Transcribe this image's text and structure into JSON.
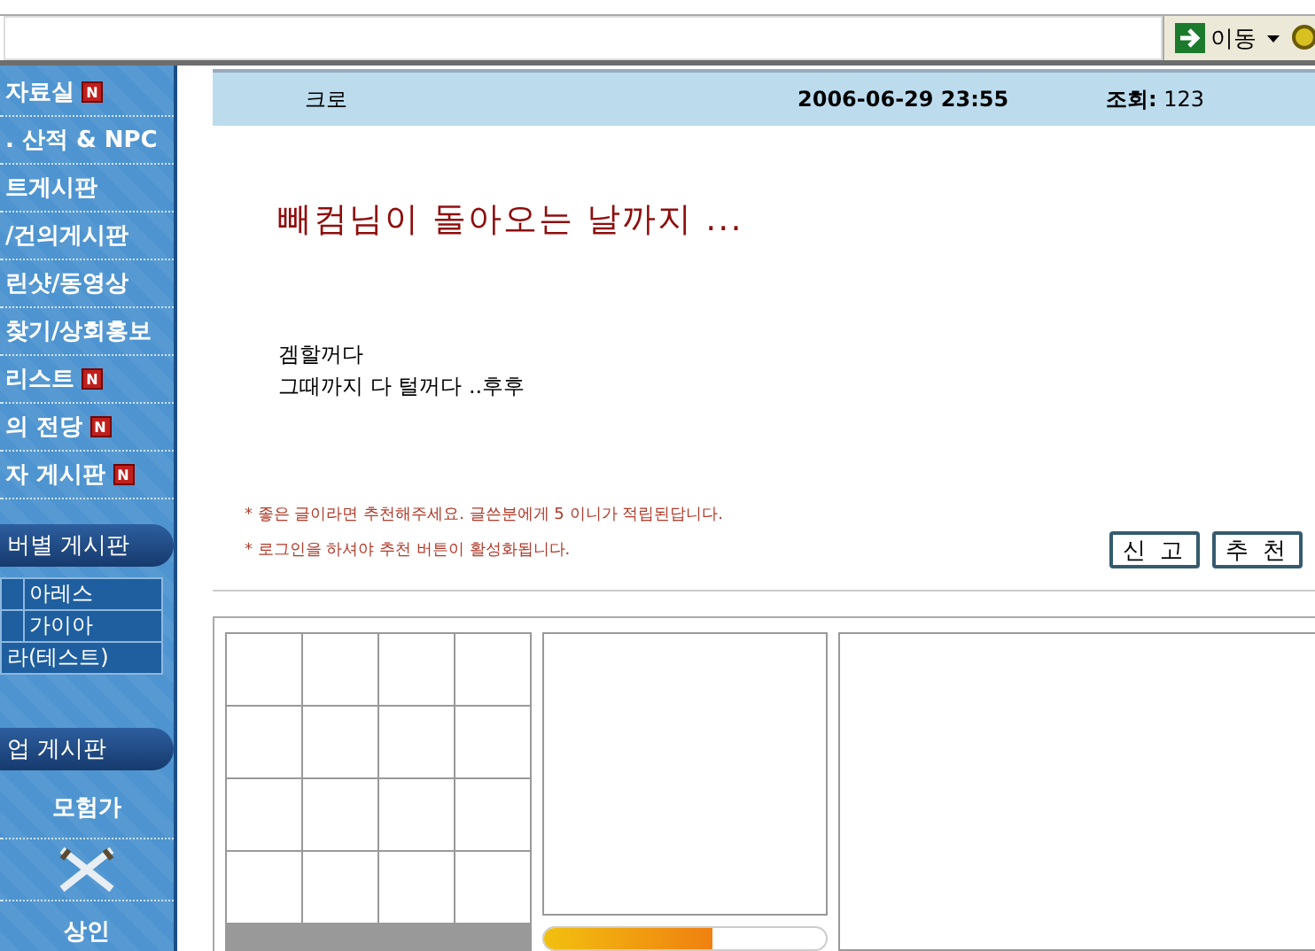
{
  "toolbar": {
    "go_button": "이동"
  },
  "sidebar": {
    "items": [
      {
        "label": "자료실",
        "badge": "N"
      },
      {
        "label": ". 산적 & NPC"
      },
      {
        "label": "트게시판"
      },
      {
        "label": "/건의게시판"
      },
      {
        "label": "린샷/동영상"
      },
      {
        "label": "찾기/상회홍보"
      },
      {
        "label": "리스트",
        "badge": "N"
      },
      {
        "label": "의 전당",
        "badge": "N"
      },
      {
        "label": "자 게시판",
        "badge": "N"
      }
    ],
    "server_banner": "버별 게시판",
    "servers": [
      {
        "name": "아레스",
        "kind": "cell"
      },
      {
        "name": "가이아",
        "kind": "cell"
      },
      {
        "name": "라(테스트)",
        "kind": "wide"
      }
    ],
    "job_banner": "업 게시판",
    "jobs": [
      {
        "label": "모험가"
      },
      {
        "label": "상인"
      }
    ]
  },
  "post": {
    "author": "크로",
    "date": "2006-06-29 23:55",
    "views_label": "조회:",
    "views": "123",
    "title": "빼컴님이 돌아오는 날까지 ...",
    "body": [
      "겜할꺼다",
      "그때까지 다 털꺼다 ..후후"
    ],
    "notes": [
      "* 좋은 글이라면 추천해주세요. 글쓴분에게 5 이니가 적립된답니다.",
      "* 로그인을 하셔야 추천 버튼이 활성화됩니다."
    ],
    "buttons": [
      "신 고",
      "추 천"
    ],
    "gauge": {
      "level": 0.6
    }
  }
}
